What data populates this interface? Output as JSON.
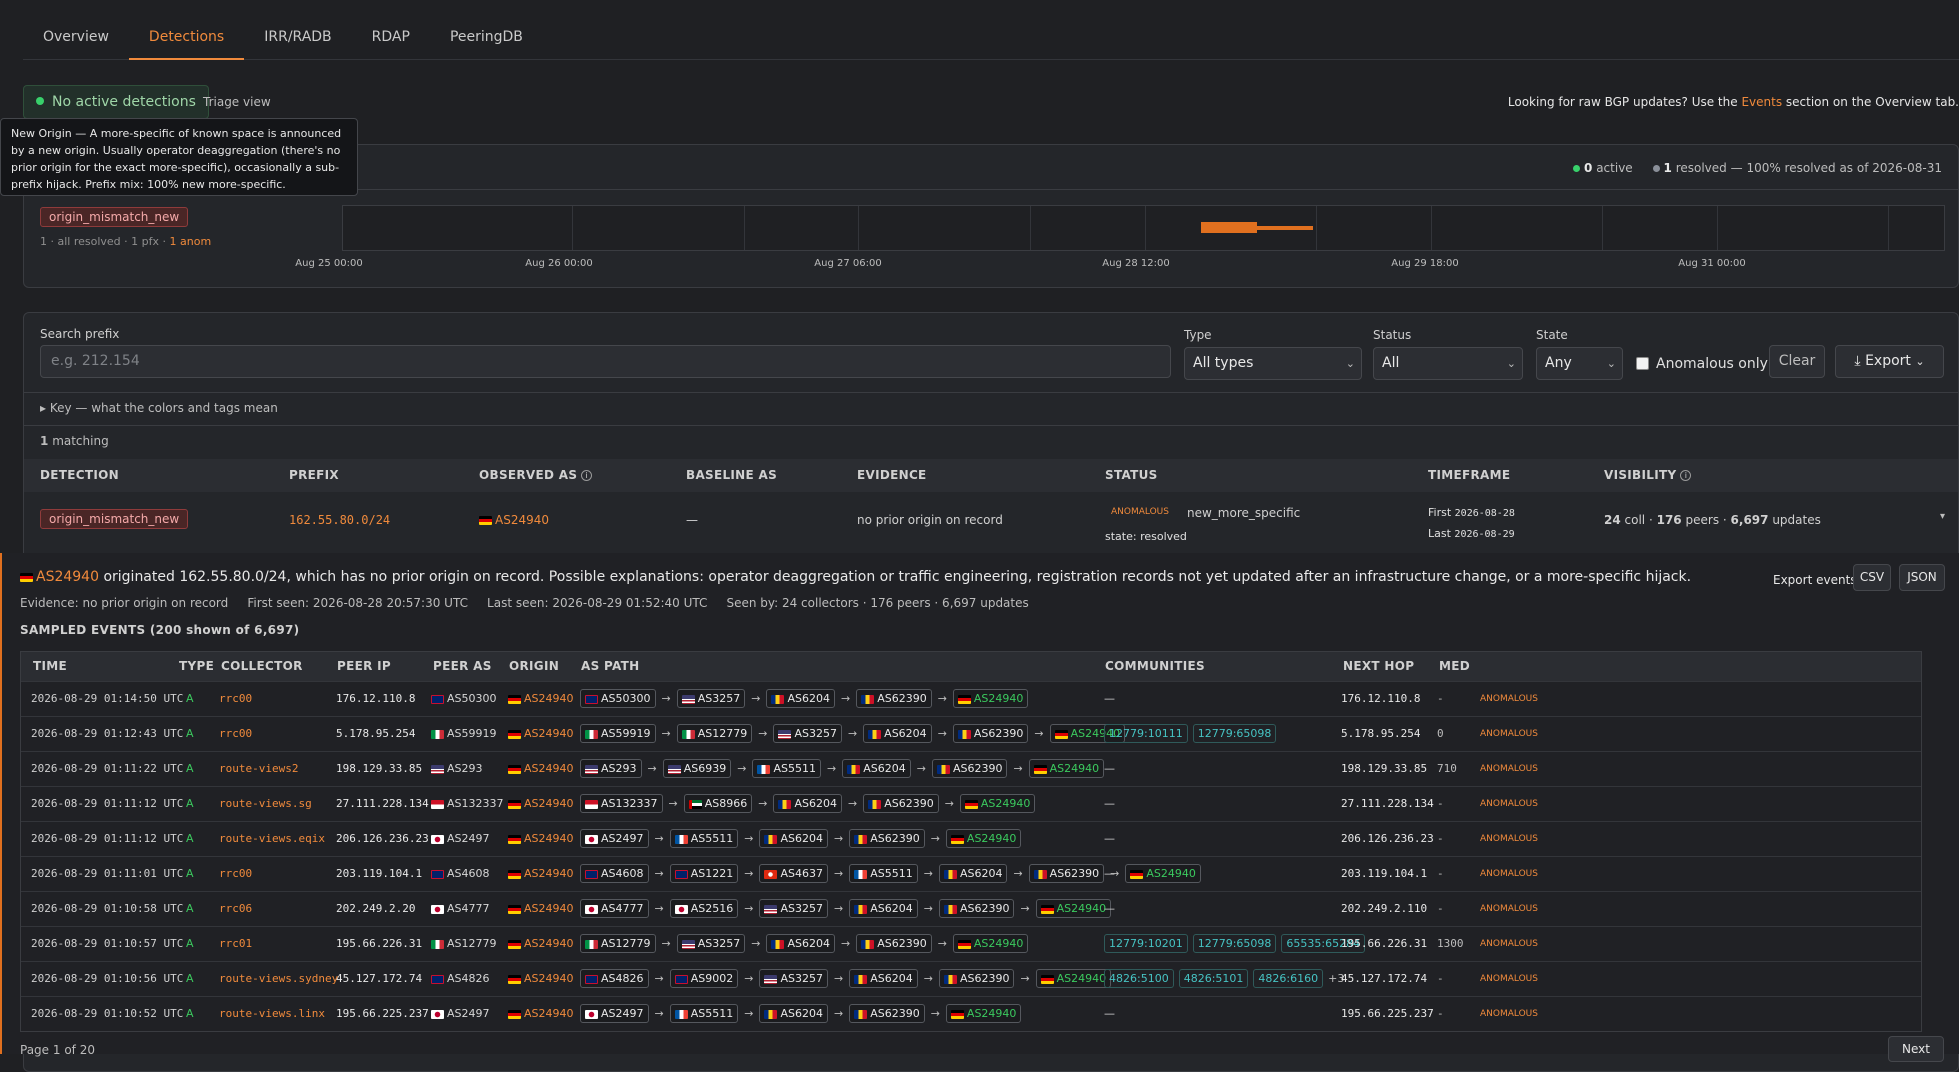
{
  "tabs": [
    "Overview",
    "Detections",
    "IRR/RADB",
    "RDAP",
    "PeeringDB"
  ],
  "status": {
    "no_active": "No active detections",
    "triage": "Triage view",
    "raw_prefix": "Looking for raw BGP updates? Use the ",
    "raw_link": "Events",
    "raw_suffix": " section on the Overview tab."
  },
  "tooltip": "New Origin — A more-specific of known space is announced by a new origin. Usually operator deaggregation (there's no prior origin for the exact more-specific), occasionally a sub-prefix hijack. Prefix mix: 100% new more-specific.",
  "timeline": {
    "active_count": "0",
    "active_text": "active",
    "resolved_count": "1",
    "resolved_text": "resolved",
    "resolved_note": "— 100% resolved as of 2026-08-31",
    "chip": "origin_mismatch_new",
    "meta": "1 · all resolved · 1 pfx · ",
    "meta_anom": "1 anom",
    "labels": [
      "Aug 25 00:00",
      "Aug 26 00:00",
      "Aug 27 06:00",
      "Aug 28 12:00",
      "Aug 29 18:00",
      "Aug 31 00:00"
    ]
  },
  "filters": {
    "search_label": "Search prefix",
    "search_placeholder": "e.g. 212.154",
    "type_label": "Type",
    "type_value": "All types",
    "status_label": "Status",
    "status_value": "All",
    "state_label": "State",
    "state_value": "Any",
    "anomalous_only": "Anomalous only",
    "clear": "Clear",
    "export": "Export"
  },
  "key": "▸ Key — what the colors and tags mean",
  "matching_count": "1",
  "matching_text": "matching",
  "columns": [
    "DETECTION",
    "PREFIX",
    "OBSERVED AS",
    "BASELINE AS",
    "EVIDENCE",
    "STATUS",
    "TIMEFRAME",
    "VISIBILITY"
  ],
  "detection": {
    "tag": "origin_mismatch_new",
    "prefix": "162.55.80.0/24",
    "observed_as": "AS24940",
    "baseline_as": "—",
    "evidence": "no prior origin on record",
    "status_badge": "ANOMALOUS",
    "status_kind": "new_more_specific",
    "state": "state: resolved",
    "first_label": "First",
    "first": "2026-08-28",
    "last_label": "Last",
    "last": "2026-08-29",
    "vis_coll": "24",
    "vis_coll_txt": "coll ·",
    "vis_peers": "176",
    "vis_peers_txt": "peers ·",
    "vis_updates": "6,697",
    "vis_updates_txt": "updates",
    "caret": "▾"
  },
  "detail": {
    "asn": "AS24940",
    "sentence": " originated 162.55.80.0/24, which has no prior origin on record. Possible explanations: operator deaggregation or traffic engineering, registration records not yet updated after an infrastructure change, or a more-specific hijack.",
    "evidence": "Evidence: no prior origin on record",
    "first_seen": "First seen: 2026-08-28 20:57:30 UTC",
    "last_seen": "Last seen: 2026-08-29 01:52:40 UTC",
    "seen_by": "Seen by: 24 collectors · 176 peers · 6,697 updates",
    "export_label": "Export events:",
    "csv": "CSV",
    "json": "JSON",
    "sampled": "SAMPLED EVENTS (200 shown of 6,697)",
    "pager": "Page 1 of 20",
    "next": "Next"
  },
  "event_columns": [
    "TIME",
    "TYPE",
    "COLLECTOR",
    "PEER IP",
    "PEER AS",
    "ORIGIN",
    "AS PATH",
    "COMMUNITIES",
    "NEXT HOP",
    "MED"
  ],
  "events": [
    {
      "time": "2026-08-29 01:14:50 UTC",
      "type": "A",
      "collector": "rrc00",
      "peer_ip": "176.12.110.8",
      "peer_as": "AS50300",
      "peer_flag": "gb",
      "origin": "AS24940",
      "path": [
        [
          "gb",
          "AS50300"
        ],
        [
          "us",
          "AS3257"
        ],
        [
          "ro",
          "AS6204"
        ],
        [
          "ro",
          "AS62390"
        ],
        [
          "de",
          "AS24940"
        ]
      ],
      "communities": [],
      "next_hop": "176.12.110.8",
      "med": "-",
      "status": "ANOMALOUS"
    },
    {
      "time": "2026-08-29 01:12:43 UTC",
      "type": "A",
      "collector": "rrc00",
      "peer_ip": "5.178.95.254",
      "peer_as": "AS59919",
      "peer_flag": "it",
      "origin": "AS24940",
      "path": [
        [
          "it",
          "AS59919"
        ],
        [
          "it",
          "AS12779"
        ],
        [
          "us",
          "AS3257"
        ],
        [
          "ro",
          "AS6204"
        ],
        [
          "ro",
          "AS62390"
        ],
        [
          "de",
          "AS24940"
        ]
      ],
      "communities": [
        "12779:10111",
        "12779:65098"
      ],
      "next_hop": "5.178.95.254",
      "med": "0",
      "status": "ANOMALOUS"
    },
    {
      "time": "2026-08-29 01:11:22 UTC",
      "type": "A",
      "collector": "route-views2",
      "peer_ip": "198.129.33.85",
      "peer_as": "AS293",
      "peer_flag": "us",
      "origin": "AS24940",
      "path": [
        [
          "us",
          "AS293"
        ],
        [
          "us",
          "AS6939"
        ],
        [
          "fr",
          "AS5511"
        ],
        [
          "ro",
          "AS6204"
        ],
        [
          "ro",
          "AS62390"
        ],
        [
          "de",
          "AS24940"
        ]
      ],
      "communities": [],
      "next_hop": "198.129.33.85",
      "med": "710",
      "status": "ANOMALOUS"
    },
    {
      "time": "2026-08-29 01:11:12 UTC",
      "type": "A",
      "collector": "route-views.sg",
      "peer_ip": "27.111.228.134",
      "peer_as": "AS132337",
      "peer_flag": "id",
      "origin": "AS24940",
      "path": [
        [
          "id",
          "AS132337"
        ],
        [
          "ae",
          "AS8966"
        ],
        [
          "ro",
          "AS6204"
        ],
        [
          "ro",
          "AS62390"
        ],
        [
          "de",
          "AS24940"
        ]
      ],
      "communities": [],
      "next_hop": "27.111.228.134",
      "med": "-",
      "status": "ANOMALOUS"
    },
    {
      "time": "2026-08-29 01:11:12 UTC",
      "type": "A",
      "collector": "route-views.eqix",
      "peer_ip": "206.126.236.23",
      "peer_as": "AS2497",
      "peer_flag": "jp",
      "origin": "AS24940",
      "path": [
        [
          "jp",
          "AS2497"
        ],
        [
          "fr",
          "AS5511"
        ],
        [
          "ro",
          "AS6204"
        ],
        [
          "ro",
          "AS62390"
        ],
        [
          "de",
          "AS24940"
        ]
      ],
      "communities": [],
      "next_hop": "206.126.236.23",
      "med": "-",
      "status": "ANOMALOUS"
    },
    {
      "time": "2026-08-29 01:11:01 UTC",
      "type": "A",
      "collector": "rrc00",
      "peer_ip": "203.119.104.1",
      "peer_as": "AS4608",
      "peer_flag": "au",
      "origin": "AS24940",
      "path": [
        [
          "au",
          "AS4608"
        ],
        [
          "au",
          "AS1221"
        ],
        [
          "hk",
          "AS4637"
        ],
        [
          "fr",
          "AS5511"
        ],
        [
          "ro",
          "AS6204"
        ],
        [
          "ro",
          "AS62390"
        ],
        [
          "de",
          "AS24940"
        ]
      ],
      "communities": [],
      "next_hop": "203.119.104.1",
      "med": "-",
      "status": "ANOMALOUS"
    },
    {
      "time": "2026-08-29 01:10:58 UTC",
      "type": "A",
      "collector": "rrc06",
      "peer_ip": "202.249.2.20",
      "peer_as": "AS4777",
      "peer_flag": "jp",
      "origin": "AS24940",
      "path": [
        [
          "jp",
          "AS4777"
        ],
        [
          "jp",
          "AS2516"
        ],
        [
          "us",
          "AS3257"
        ],
        [
          "ro",
          "AS6204"
        ],
        [
          "ro",
          "AS62390"
        ],
        [
          "de",
          "AS24940"
        ]
      ],
      "communities": [],
      "next_hop": "202.249.2.110",
      "med": "-",
      "status": "ANOMALOUS"
    },
    {
      "time": "2026-08-29 01:10:57 UTC",
      "type": "A",
      "collector": "rrc01",
      "peer_ip": "195.66.226.31",
      "peer_as": "AS12779",
      "peer_flag": "it",
      "origin": "AS24940",
      "path": [
        [
          "it",
          "AS12779"
        ],
        [
          "us",
          "AS3257"
        ],
        [
          "ro",
          "AS6204"
        ],
        [
          "ro",
          "AS62390"
        ],
        [
          "de",
          "AS24940"
        ]
      ],
      "communities": [
        "12779:10201",
        "12779:65098",
        "65535:65284"
      ],
      "next_hop": "195.66.226.31",
      "med": "1300",
      "status": "ANOMALOUS"
    },
    {
      "time": "2026-08-29 01:10:56 UTC",
      "type": "A",
      "collector": "route-views.sydney",
      "peer_ip": "45.127.172.74",
      "peer_as": "AS4826",
      "peer_flag": "au",
      "origin": "AS24940",
      "path": [
        [
          "au",
          "AS4826"
        ],
        [
          "gb",
          "AS9002"
        ],
        [
          "us",
          "AS3257"
        ],
        [
          "ro",
          "AS6204"
        ],
        [
          "ro",
          "AS62390"
        ],
        [
          "de",
          "AS24940"
        ]
      ],
      "communities": [
        "4826:5100",
        "4826:5101",
        "4826:6160"
      ],
      "communities_more": "+3",
      "next_hop": "45.127.172.74",
      "med": "-",
      "status": "ANOMALOUS"
    },
    {
      "time": "2026-08-29 01:10:52 UTC",
      "type": "A",
      "collector": "route-views.linx",
      "peer_ip": "195.66.225.237",
      "peer_as": "AS2497",
      "peer_flag": "jp",
      "origin": "AS24940",
      "path": [
        [
          "jp",
          "AS2497"
        ],
        [
          "fr",
          "AS5511"
        ],
        [
          "ro",
          "AS6204"
        ],
        [
          "ro",
          "AS62390"
        ],
        [
          "de",
          "AS24940"
        ]
      ],
      "communities": [],
      "next_hop": "195.66.225.237",
      "med": "-",
      "status": "ANOMALOUS"
    }
  ],
  "colors": {
    "accent": "#f08a3c",
    "green": "#3bc95e",
    "teal": "#46c3c3",
    "danger": "#f4a9a9"
  }
}
